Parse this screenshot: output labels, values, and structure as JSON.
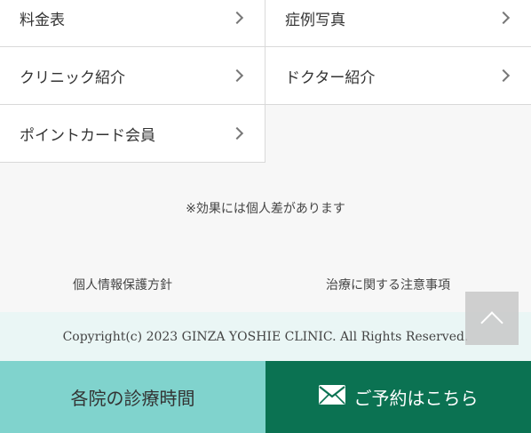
{
  "menu": {
    "items": [
      {
        "label": "料金表"
      },
      {
        "label": "症例写真"
      },
      {
        "label": "クリニック紹介"
      },
      {
        "label": "ドクター紹介"
      },
      {
        "label": "ポイントカード会員"
      }
    ]
  },
  "note": "※効果には個人差があります",
  "footer_links": {
    "privacy": "個人情報保護方針",
    "caution": "治療に関する注意事項"
  },
  "copyright": "Copyright(c) 2023 GINZA YOSHIE CLINIC. All Rights Reserved.",
  "bottom_bar": {
    "hours_label": "各院の診療時間",
    "reserve_label": "ご予約はこちら"
  },
  "colors": {
    "accent_light": "#80d3cd",
    "accent_dark": "#0b7252",
    "copyright_bg": "#eaf6f5"
  },
  "icons": {
    "menu_arrow": "chevron-right-icon",
    "back_to_top": "chevron-up-icon",
    "reserve": "mail-icon"
  }
}
